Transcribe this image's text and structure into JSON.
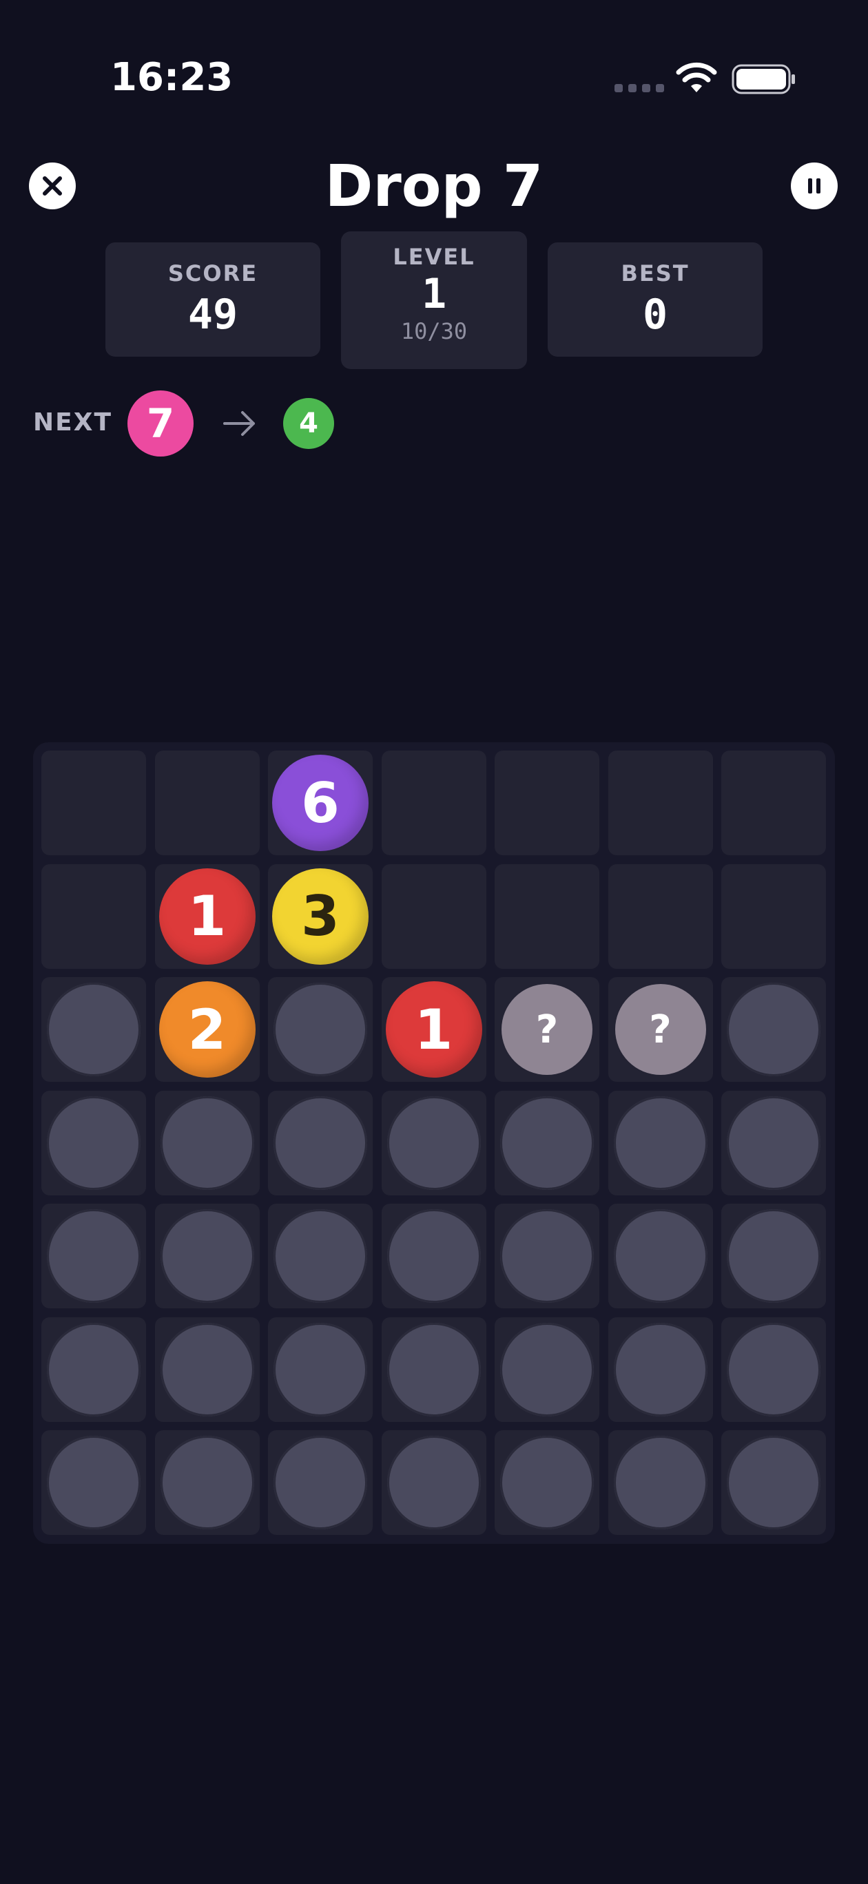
{
  "status_bar": {
    "time": "16:23",
    "icons": [
      "signal-dots-icon",
      "wifi-icon",
      "battery-icon"
    ]
  },
  "header": {
    "title": "Drop 7",
    "close_icon": "close-icon",
    "pause_icon": "pause-icon"
  },
  "stats": {
    "score": {
      "label": "SCORE",
      "value": "49"
    },
    "level": {
      "label": "LEVEL",
      "value": "1",
      "progress": "10/30"
    },
    "best": {
      "label": "BEST",
      "value": "0"
    }
  },
  "next": {
    "label": "NEXT",
    "current": {
      "value": "7",
      "color": "#ec4aa0"
    },
    "arrow_icon": "arrow-right-icon",
    "after": {
      "value": "4",
      "color": "#4cb84f"
    }
  },
  "colors": {
    "background": "#10101f",
    "panel": "#232333",
    "board": "#18182a",
    "ball_1": "#dd3a3a",
    "ball_2": "#f08a2a",
    "ball_3": "#f2d431",
    "ball_4": "#4cb84f",
    "ball_6": "#8a4fd8",
    "ball_7": "#ec4aa0",
    "ball_mystery": "#8f8593",
    "ball_empty": "#4a4a5e"
  },
  "board": {
    "rows": [
      [
        "",
        "",
        "6",
        "",
        "",
        "",
        ""
      ],
      [
        "",
        "1",
        "3",
        "",
        "",
        "",
        ""
      ],
      [
        "e",
        "2",
        "e",
        "1",
        "?",
        "?",
        "e"
      ],
      [
        "e",
        "e",
        "e",
        "e",
        "e",
        "e",
        "e"
      ],
      [
        "e",
        "e",
        "e",
        "e",
        "e",
        "e",
        "e"
      ],
      [
        "e",
        "e",
        "e",
        "e",
        "e",
        "e",
        "e"
      ],
      [
        "e",
        "e",
        "e",
        "e",
        "e",
        "e",
        "e"
      ]
    ]
  }
}
